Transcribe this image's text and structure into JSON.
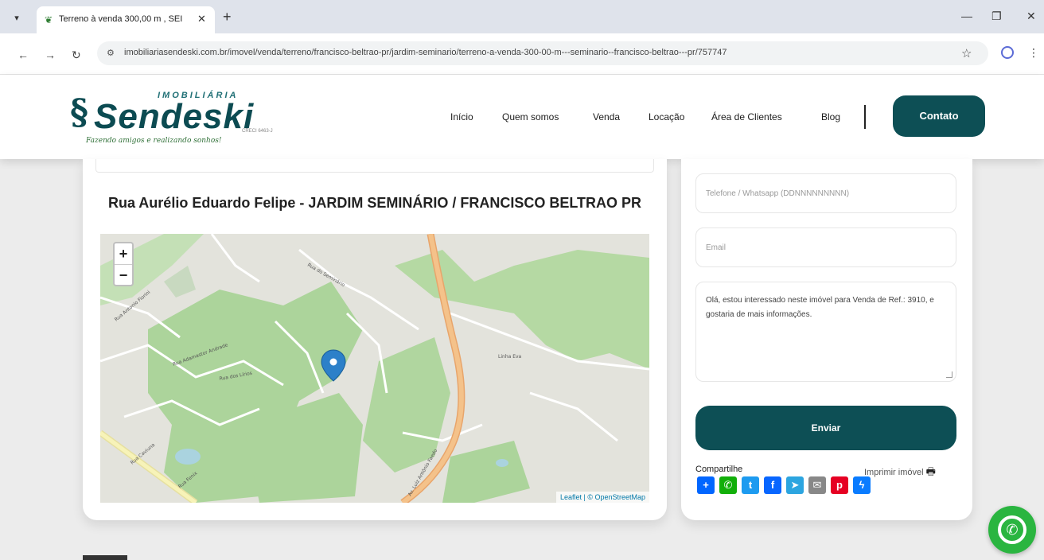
{
  "browser": {
    "tab_title": "Terreno à venda 300,00 m , SEI",
    "url": "imobiliariasendeski.com.br/imovel/venda/terreno/francisco-beltrao-pr/jardim-seminario/terreno-a-venda-300-00-m---seminario--francisco-beltrao---pr/757747"
  },
  "logo": {
    "top_text": "IMOBILIÁRIA",
    "main_text": "Sendeski",
    "creci": "CRECI 6463-J",
    "slogan": "Fazendo amigos e realizando sonhos!"
  },
  "nav": {
    "items": [
      "Início",
      "Quem somos",
      "Venda",
      "Locação",
      "Área de Clientes",
      "Blog"
    ],
    "contact_button": "Contato"
  },
  "map_section": {
    "title": "Rua Aurélio Eduardo Felipe - JARDIM SEMINÁRIO / FRANCISCO BELTRAO PR",
    "zoom_in": "+",
    "zoom_out": "−",
    "attribution": "Leaflet | © OpenStreetMap",
    "street_labels": [
      "Rua Adamastor Andrade",
      "Rua dos Lírios",
      "Rua do Seminário",
      "Linha Eva",
      "Av. Luiz Antônio Faedo",
      "Rua Antonio Fiorini",
      "Rua Caviuna",
      "Rua Fenix"
    ]
  },
  "form": {
    "phone_placeholder": "Telefone / Whatsapp (DDNNNNNNNNN)",
    "email_placeholder": "Email",
    "message": "Olá, estou interessado neste imóvel para Venda de Ref.: 3910, e gostaria de mais informações.",
    "send_button": "Enviar",
    "share_label": "Compartilhe",
    "print_label": "Imprimir imóvel"
  },
  "colors": {
    "brand": "#0d4f55",
    "whatsapp": "#2ab540"
  }
}
